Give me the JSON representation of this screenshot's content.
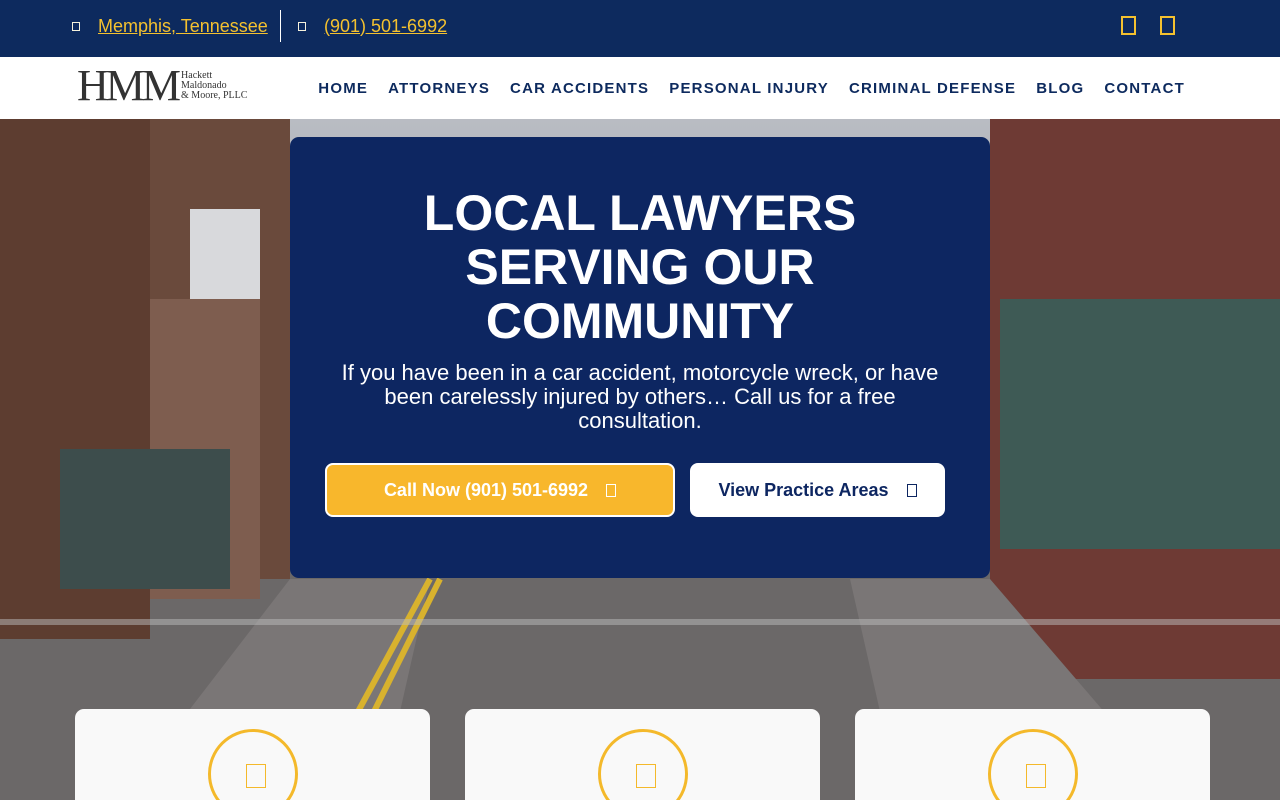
{
  "topbar": {
    "location": "Memphis, Tennessee",
    "phone": "(901) 501-6992",
    "social": [
      "facebook-icon",
      "linkedin-icon"
    ]
  },
  "logo": {
    "mark": "HMM",
    "line1": "Hackett",
    "line2": "Maldonado",
    "line3": "& Moore, PLLC"
  },
  "nav": {
    "items": [
      "HOME",
      "ATTORNEYS",
      "CAR ACCIDENTS",
      "PERSONAL INJURY",
      "CRIMINAL DEFENSE",
      "BLOG",
      "CONTACT"
    ]
  },
  "hero": {
    "headline": "LOCAL LAWYERS SERVING OUR COMMUNITY",
    "subtext": "If you have been in a car accident, motorcycle wreck, or have been carelessly injured by others… Call us for a free consultation.",
    "call_button": "Call Now (901) 501-6992",
    "view_button": "View Practice Areas"
  },
  "features": [
    {
      "icon": "feature-icon"
    },
    {
      "icon": "feature-icon"
    },
    {
      "icon": "feature-icon"
    }
  ],
  "colors": {
    "navy": "#0d2a5e",
    "gold": "#f8b72c",
    "white": "#ffffff"
  }
}
